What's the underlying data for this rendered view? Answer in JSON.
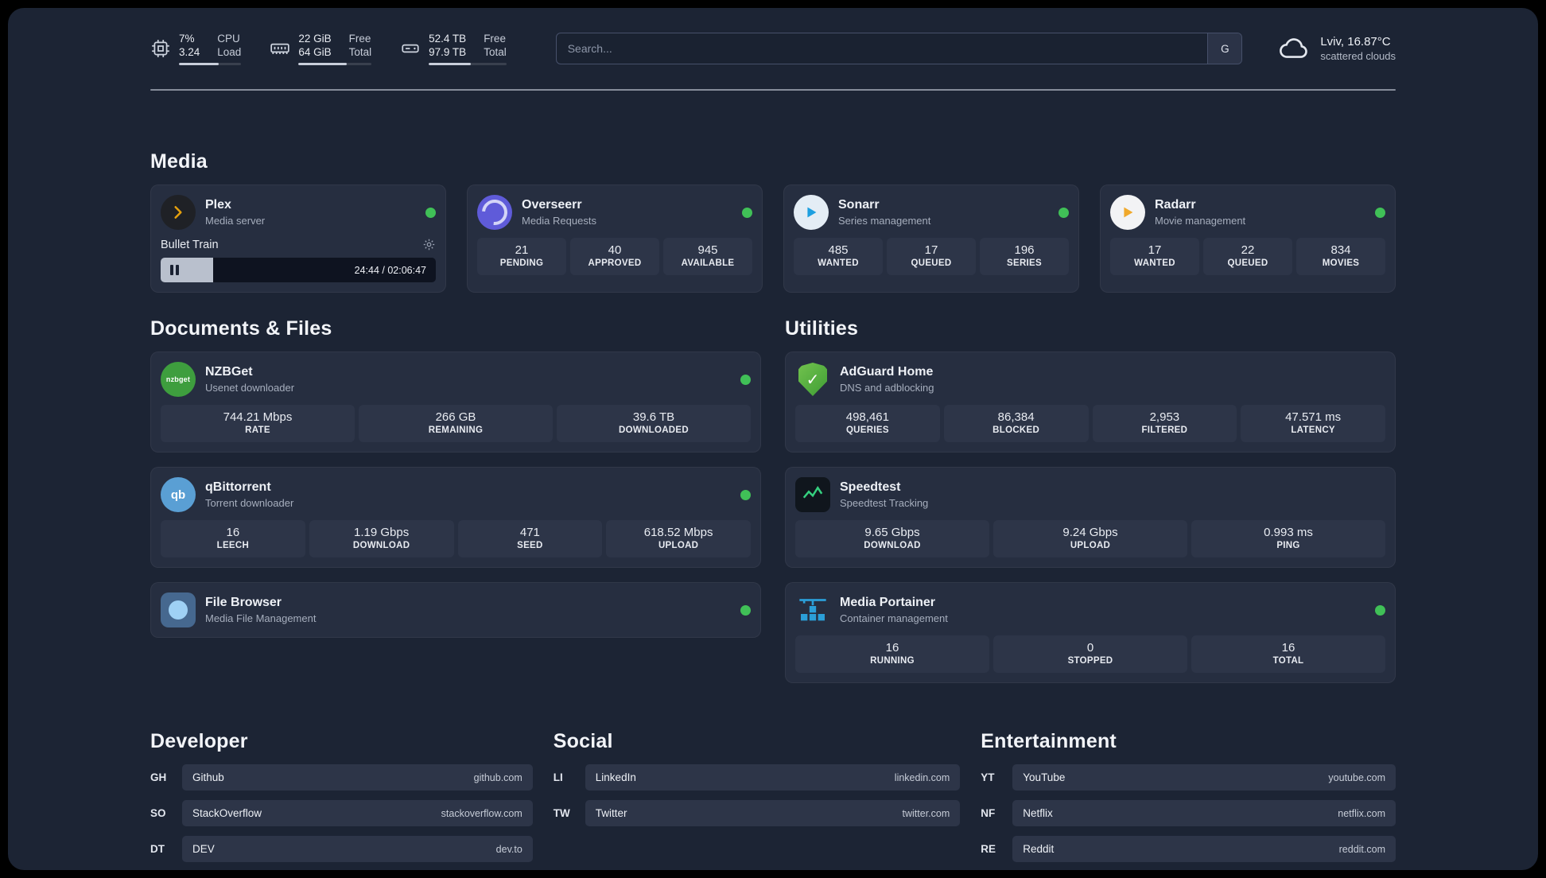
{
  "topbar": {
    "cpu": {
      "value_top": "7%",
      "value_bottom": "3.24",
      "label_top": "CPU",
      "label_bottom": "Load",
      "bar_percent": 64
    },
    "ram": {
      "value_top": "22 GiB",
      "value_bottom": "64 GiB",
      "label_top": "Free",
      "label_bottom": "Total",
      "bar_percent": 66
    },
    "disk": {
      "value_top": "52.4 TB",
      "value_bottom": "97.9 TB",
      "label_top": "Free",
      "label_bottom": "Total",
      "bar_percent": 54
    },
    "search": {
      "placeholder": "Search...",
      "engine_button": "G"
    },
    "weather": {
      "location": "Lviv, 16.87°C",
      "condition": "scattered clouds"
    }
  },
  "media": {
    "title": "Media",
    "plex": {
      "name": "Plex",
      "subtitle": "Media server",
      "now_playing": "Bullet Train",
      "time": "24:44 / 02:06:47",
      "progress_percent": 19
    },
    "overseerr": {
      "name": "Overseerr",
      "subtitle": "Media Requests",
      "stats": [
        {
          "value": "21",
          "label": "PENDING"
        },
        {
          "value": "40",
          "label": "APPROVED"
        },
        {
          "value": "945",
          "label": "AVAILABLE"
        }
      ]
    },
    "sonarr": {
      "name": "Sonarr",
      "subtitle": "Series management",
      "stats": [
        {
          "value": "485",
          "label": "WANTED"
        },
        {
          "value": "17",
          "label": "QUEUED"
        },
        {
          "value": "196",
          "label": "SERIES"
        }
      ]
    },
    "radarr": {
      "name": "Radarr",
      "subtitle": "Movie management",
      "stats": [
        {
          "value": "17",
          "label": "WANTED"
        },
        {
          "value": "22",
          "label": "QUEUED"
        },
        {
          "value": "834",
          "label": "MOVIES"
        }
      ]
    }
  },
  "documents": {
    "title": "Documents & Files",
    "nzbget": {
      "name": "NZBGet",
      "subtitle": "Usenet downloader",
      "icon_text": "nzbget",
      "stats": [
        {
          "value": "744.21 Mbps",
          "label": "RATE"
        },
        {
          "value": "266 GB",
          "label": "REMAINING"
        },
        {
          "value": "39.6 TB",
          "label": "DOWNLOADED"
        }
      ]
    },
    "qbittorrent": {
      "name": "qBittorrent",
      "subtitle": "Torrent downloader",
      "icon_text": "qb",
      "stats": [
        {
          "value": "16",
          "label": "LEECH"
        },
        {
          "value": "1.19 Gbps",
          "label": "DOWNLOAD"
        },
        {
          "value": "471",
          "label": "SEED"
        },
        {
          "value": "618.52 Mbps",
          "label": "UPLOAD"
        }
      ]
    },
    "filebrowser": {
      "name": "File Browser",
      "subtitle": "Media File Management"
    }
  },
  "utilities": {
    "title": "Utilities",
    "adguard": {
      "name": "AdGuard Home",
      "subtitle": "DNS and adblocking",
      "shield_check": "✓",
      "stats": [
        {
          "value": "498,461",
          "label": "QUERIES"
        },
        {
          "value": "86,384",
          "label": "BLOCKED"
        },
        {
          "value": "2,953",
          "label": "FILTERED"
        },
        {
          "value": "47.571 ms",
          "label": "LATENCY"
        }
      ]
    },
    "speedtest": {
      "name": "Speedtest",
      "subtitle": "Speedtest Tracking",
      "stats": [
        {
          "value": "9.65 Gbps",
          "label": "DOWNLOAD"
        },
        {
          "value": "9.24 Gbps",
          "label": "UPLOAD"
        },
        {
          "value": "0.993 ms",
          "label": "PING"
        }
      ]
    },
    "portainer": {
      "name": "Media Portainer",
      "subtitle": "Container management",
      "stats": [
        {
          "value": "16",
          "label": "RUNNING"
        },
        {
          "value": "0",
          "label": "STOPPED"
        },
        {
          "value": "16",
          "label": "TOTAL"
        }
      ]
    }
  },
  "bookmarks": {
    "developer": {
      "title": "Developer",
      "items": [
        {
          "abbr": "GH",
          "name": "Github",
          "url": "github.com"
        },
        {
          "abbr": "SO",
          "name": "StackOverflow",
          "url": "stackoverflow.com"
        },
        {
          "abbr": "DT",
          "name": "DEV",
          "url": "dev.to"
        }
      ]
    },
    "social": {
      "title": "Social",
      "items": [
        {
          "abbr": "LI",
          "name": "LinkedIn",
          "url": "linkedin.com"
        },
        {
          "abbr": "TW",
          "name": "Twitter",
          "url": "twitter.com"
        }
      ]
    },
    "entertainment": {
      "title": "Entertainment",
      "items": [
        {
          "abbr": "YT",
          "name": "YouTube",
          "url": "youtube.com"
        },
        {
          "abbr": "NF",
          "name": "Netflix",
          "url": "netflix.com"
        },
        {
          "abbr": "RE",
          "name": "Reddit",
          "url": "reddit.com"
        }
      ]
    }
  },
  "colors": {
    "status_green": "#40c057",
    "plex_amber": "#e5a00d",
    "background": "#1c2434",
    "card": "#262e40"
  }
}
